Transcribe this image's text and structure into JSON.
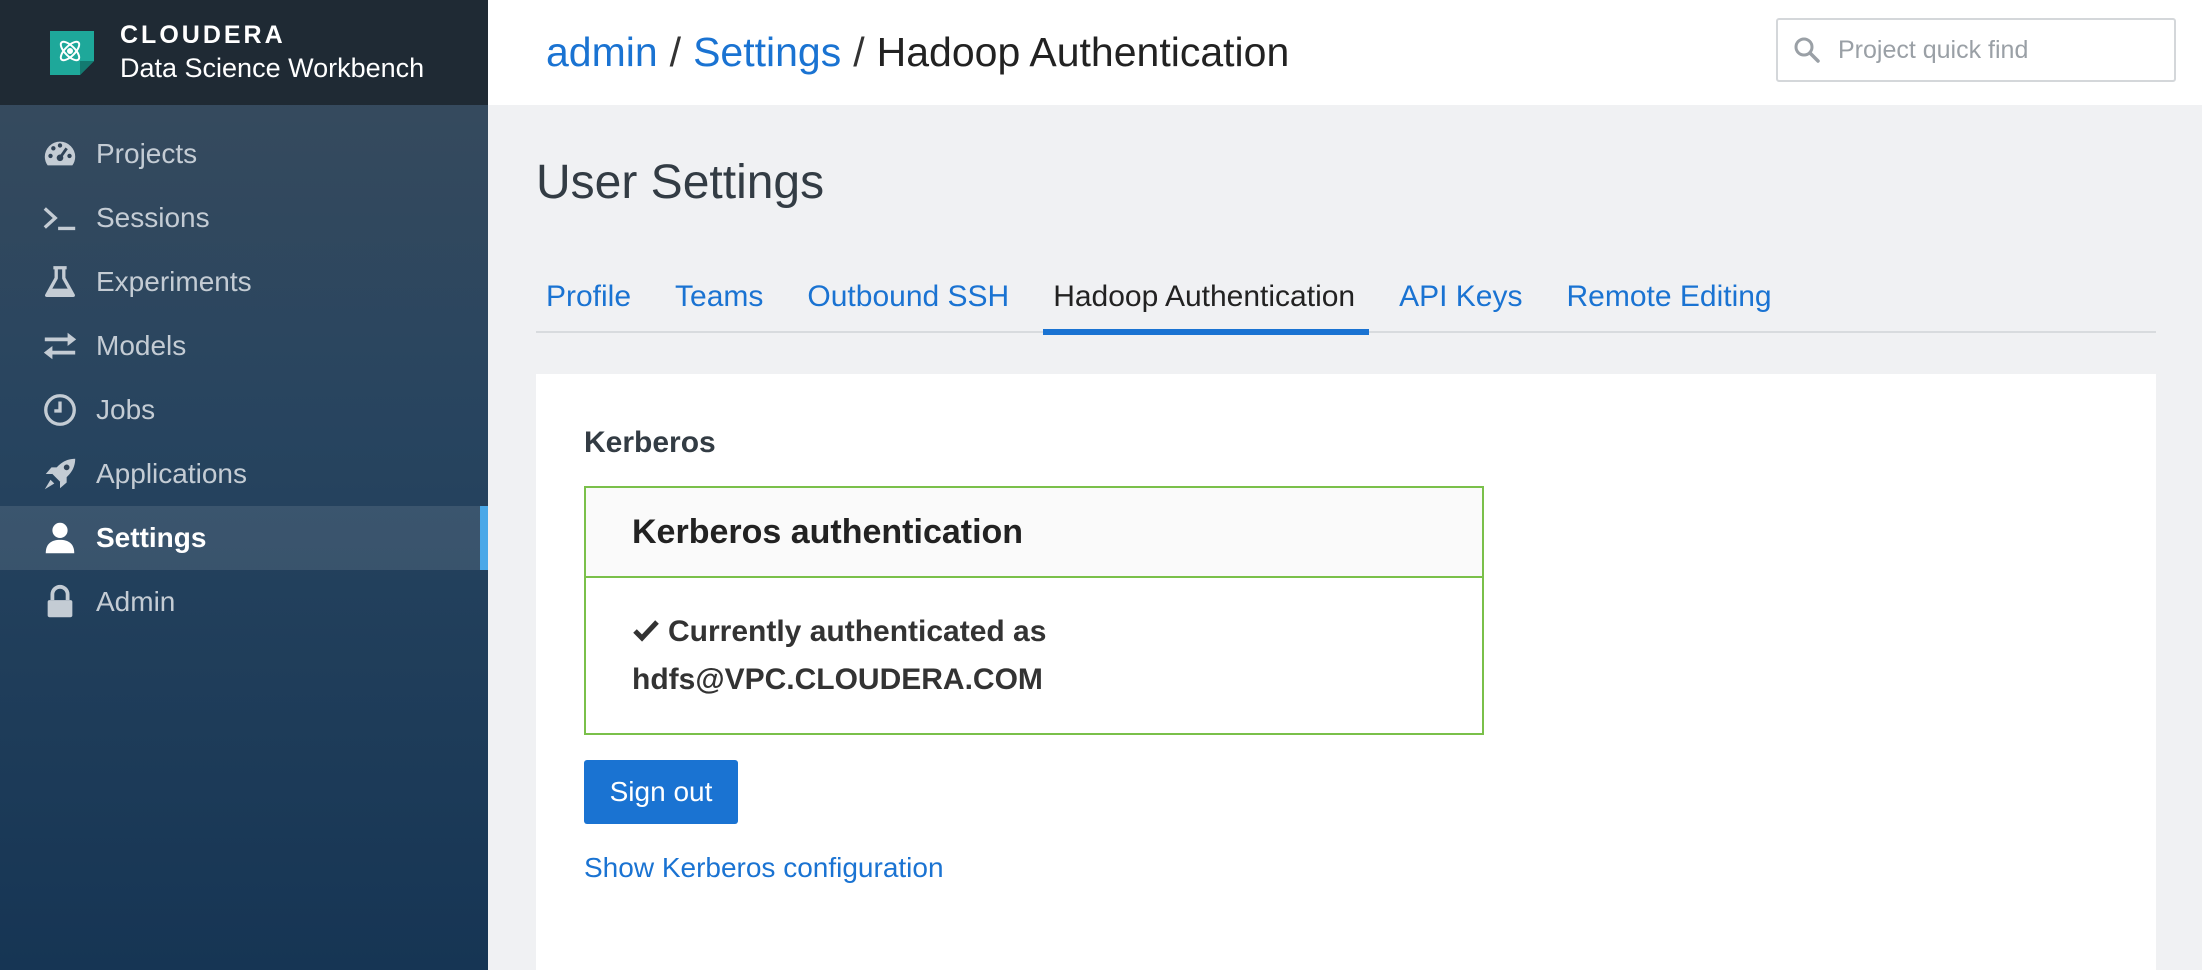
{
  "brand": {
    "name": "CLOUDERA",
    "product": "Data Science Workbench"
  },
  "sidebar": {
    "items": [
      {
        "label": "Projects",
        "icon": "dashboard-icon"
      },
      {
        "label": "Sessions",
        "icon": "terminal-icon"
      },
      {
        "label": "Experiments",
        "icon": "flask-icon"
      },
      {
        "label": "Models",
        "icon": "exchange-arrows-icon"
      },
      {
        "label": "Jobs",
        "icon": "clock-icon"
      },
      {
        "label": "Applications",
        "icon": "rocket-icon"
      },
      {
        "label": "Settings",
        "icon": "user-icon",
        "active": true
      },
      {
        "label": "Admin",
        "icon": "lock-icon"
      }
    ]
  },
  "header": {
    "breadcrumb": {
      "crumb1": "admin",
      "crumb2": "Settings",
      "current": "Hadoop Authentication",
      "separator": "/"
    },
    "search": {
      "placeholder": "Project quick find",
      "value": ""
    }
  },
  "main": {
    "title": "User Settings",
    "tabs": [
      {
        "label": "Profile"
      },
      {
        "label": "Teams"
      },
      {
        "label": "Outbound SSH"
      },
      {
        "label": "Hadoop Authentication",
        "active": true
      },
      {
        "label": "API Keys"
      },
      {
        "label": "Remote Editing"
      }
    ],
    "kerberos": {
      "section_label": "Kerberos",
      "box_title": "Kerberos authentication",
      "status_line": "Currently authenticated as",
      "principal": "hdfs@VPC.CLOUDERA.COM",
      "signout_label": "Sign out",
      "config_link": "Show Kerberos configuration"
    }
  },
  "colors": {
    "accent": "#1a73d2",
    "success_border": "#7ac04a",
    "sidebar_active_bar": "#4aa8e8"
  }
}
